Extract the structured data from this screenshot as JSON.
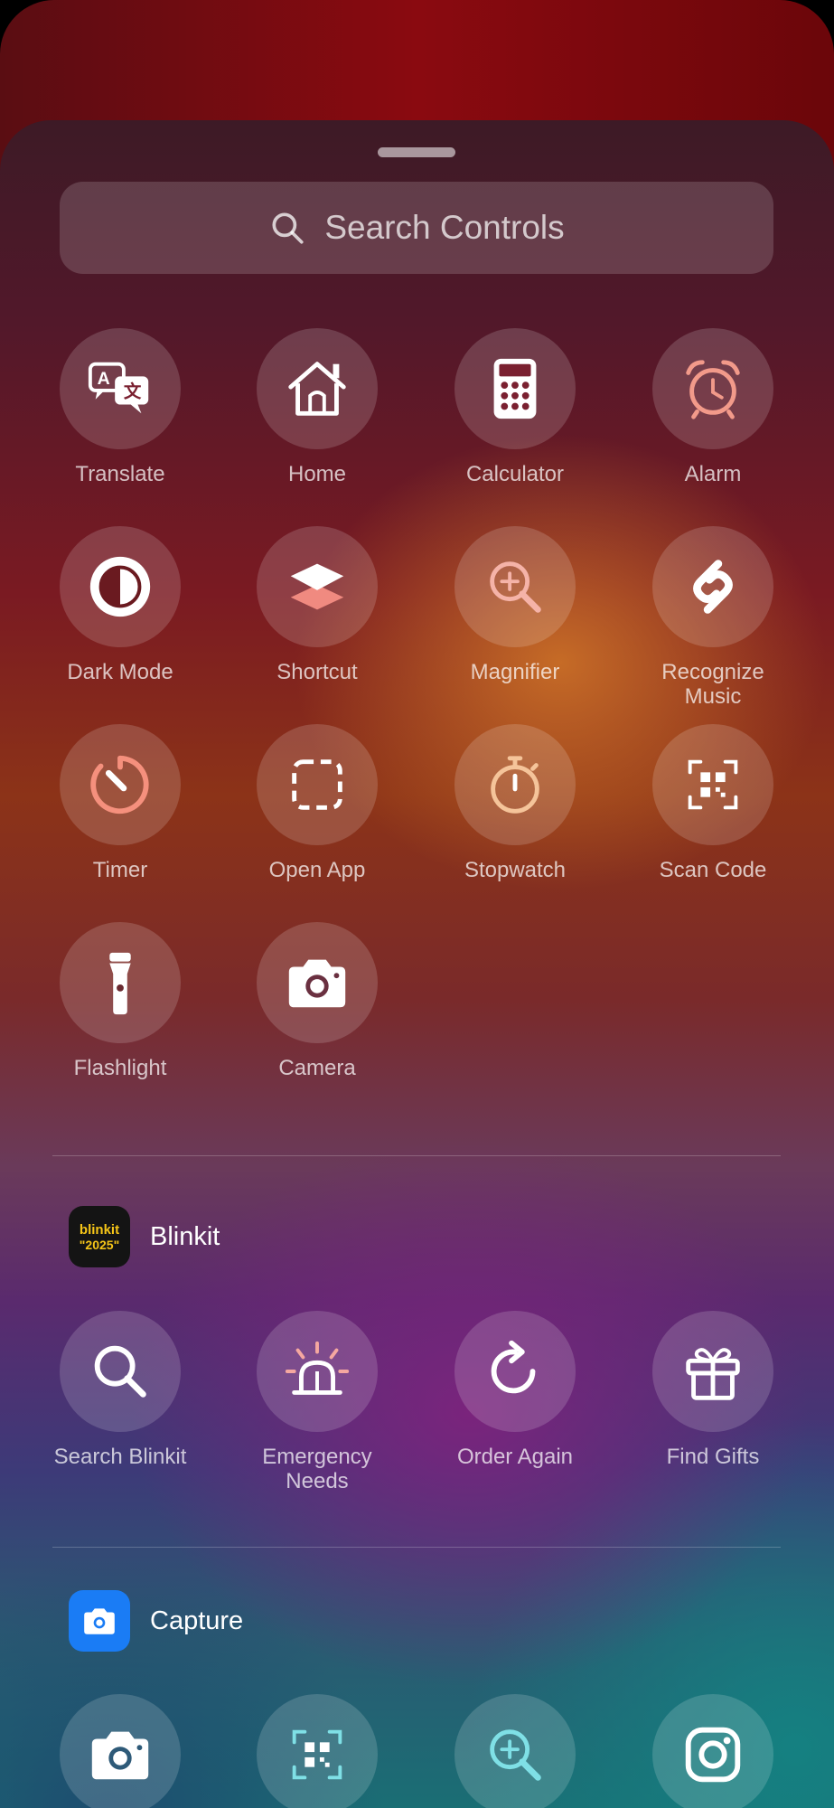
{
  "search": {
    "placeholder": "Search Controls"
  },
  "controls": [
    {
      "label": "Translate",
      "icon": "translate-icon"
    },
    {
      "label": "Home",
      "icon": "home-icon"
    },
    {
      "label": "Calculator",
      "icon": "calculator-icon"
    },
    {
      "label": "Alarm",
      "icon": "alarm-icon"
    },
    {
      "label": "Dark Mode",
      "icon": "dark-mode-icon"
    },
    {
      "label": "Shortcut",
      "icon": "shortcut-icon"
    },
    {
      "label": "Magnifier",
      "icon": "magnifier-icon"
    },
    {
      "label": "Recognize\nMusic",
      "icon": "shazam-icon"
    },
    {
      "label": "Timer",
      "icon": "timer-icon"
    },
    {
      "label": "Open App",
      "icon": "open-app-icon"
    },
    {
      "label": "Stopwatch",
      "icon": "stopwatch-icon"
    },
    {
      "label": "Scan Code",
      "icon": "qr-code-icon"
    },
    {
      "label": "Flashlight",
      "icon": "flashlight-icon"
    },
    {
      "label": "Camera",
      "icon": "camera-icon"
    }
  ],
  "blinkit": {
    "name": "Blinkit",
    "icon_text": "blinkit",
    "icon_year": "\"2025\"",
    "controls": [
      {
        "label": "Search Blinkit",
        "icon": "search-icon"
      },
      {
        "label": "Emergency\nNeeds",
        "icon": "siren-icon"
      },
      {
        "label": "Order Again",
        "icon": "reorder-icon"
      },
      {
        "label": "Find Gifts",
        "icon": "gift-icon"
      }
    ]
  },
  "capture": {
    "name": "Capture",
    "controls": [
      {
        "label": "",
        "icon": "camera-icon"
      },
      {
        "label": "",
        "icon": "qr-code-icon"
      },
      {
        "label": "",
        "icon": "magnifier-icon"
      },
      {
        "label": "",
        "icon": "instagram-icon"
      }
    ]
  },
  "colors": {
    "alarm": "#f29a8a",
    "shortcut": "#f4a8a0",
    "timer": "#f5907d",
    "stopwatch": "#f5c49a",
    "magnifier": "#f5b3a8",
    "capture_blue": "#1a7cf5",
    "accent_teal": "#7fe0e6"
  }
}
